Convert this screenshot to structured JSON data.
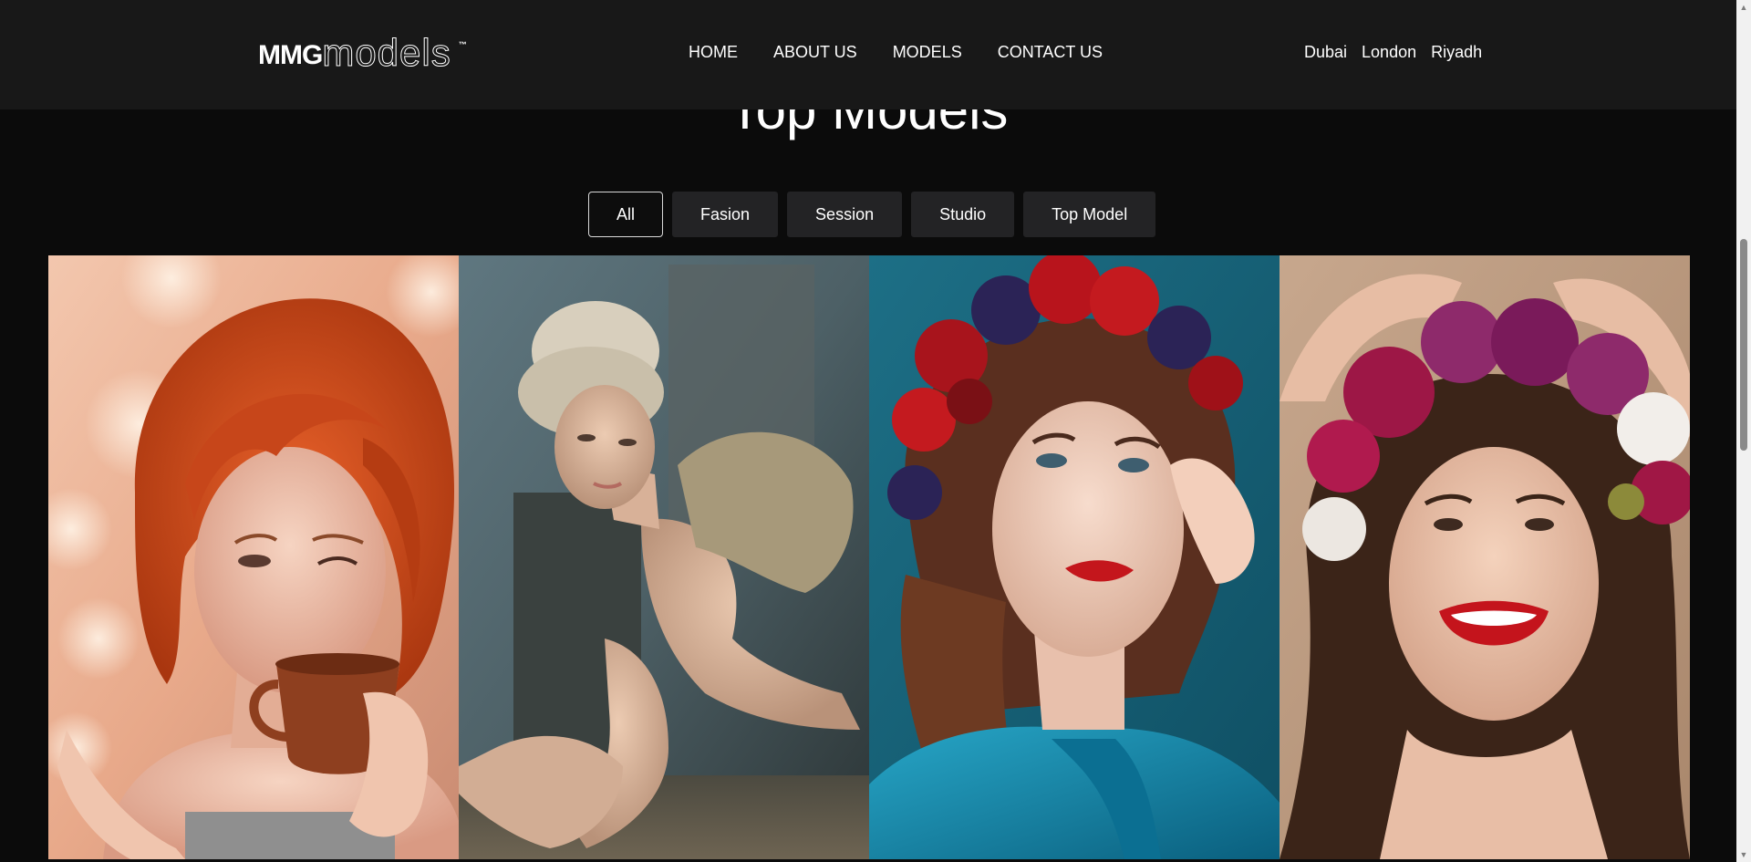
{
  "header": {
    "logo": {
      "brand_bold": "MMG",
      "brand_light": "models",
      "trademark": "™"
    },
    "nav": [
      {
        "label": "HOME"
      },
      {
        "label": "ABOUT US"
      },
      {
        "label": "MODELS"
      },
      {
        "label": "CONTACT US"
      }
    ],
    "cities": [
      {
        "label": "Dubai"
      },
      {
        "label": "London"
      },
      {
        "label": "Riyadh"
      }
    ]
  },
  "section": {
    "title": "Top Models"
  },
  "filters": [
    {
      "label": "All",
      "active": true
    },
    {
      "label": "Fasion",
      "active": false
    },
    {
      "label": "Session",
      "active": false
    },
    {
      "label": "Studio",
      "active": false
    },
    {
      "label": "Top Model",
      "active": false
    }
  ],
  "gallery": [
    {
      "name": "model-photo-redhead-coffee"
    },
    {
      "name": "model-photo-blonde-seated"
    },
    {
      "name": "model-photo-flower-crown-blue"
    },
    {
      "name": "model-photo-flower-crown-smile"
    }
  ],
  "colors": {
    "background": "#0b0b0b",
    "header": "#181818",
    "button": "#232325",
    "active_border": "#d9d9d9"
  }
}
